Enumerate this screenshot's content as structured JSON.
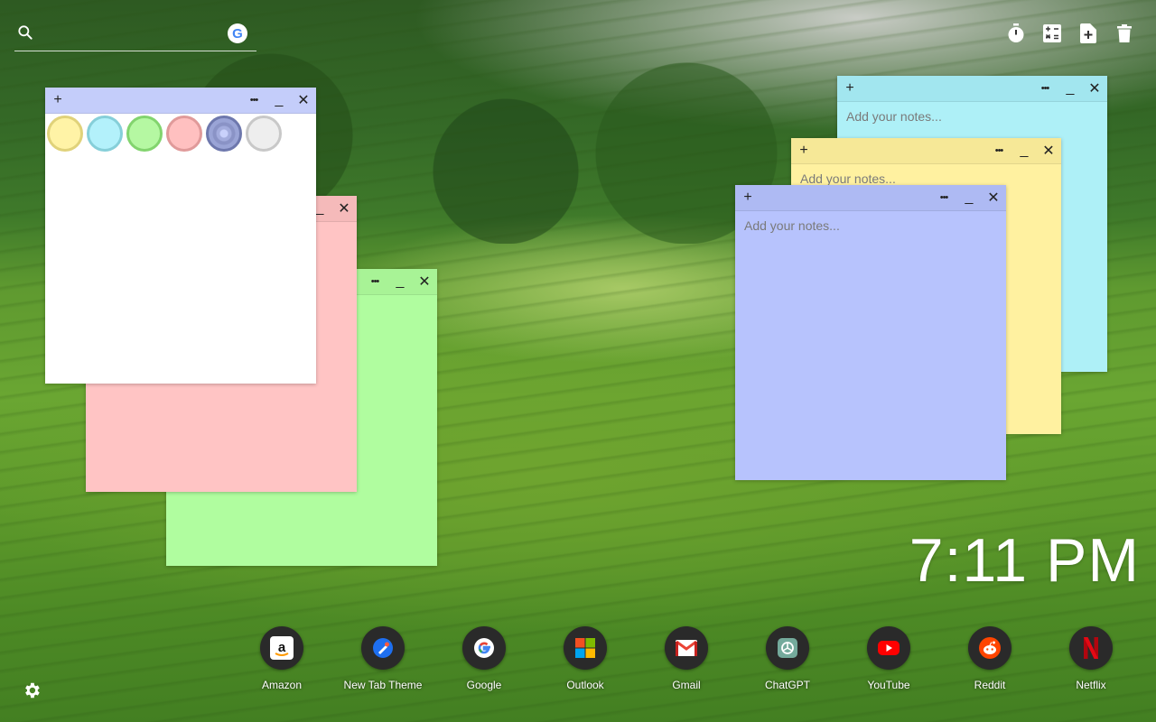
{
  "search": {
    "placeholder": "",
    "engine_icon": "google-g-icon",
    "engine_letter": "G"
  },
  "toolbar": {
    "icons": [
      "timer-icon",
      "calculator-icon",
      "new-note-icon",
      "trash-icon"
    ]
  },
  "notes": {
    "placeholder": "Add your notes...",
    "add_label": "+",
    "menu_label": "•••",
    "minimize_label": "_",
    "close_label": "✕",
    "colors": [
      "#f7ec9c",
      "#aef0f7",
      "#b0f59e",
      "#ffc4c4",
      "#b9c4fd",
      "#eeeeee"
    ],
    "picker_colors": [
      {
        "name": "yellow",
        "fill": "#fff3a6",
        "ring": "#e0d27a"
      },
      {
        "name": "cyan",
        "fill": "#b3f1fb",
        "ring": "#86cfd9"
      },
      {
        "name": "green",
        "fill": "#b5f8a2",
        "ring": "#82d46e"
      },
      {
        "name": "pink",
        "fill": "#ffc0c0",
        "ring": "#e09a9a"
      },
      {
        "name": "blue",
        "fill": "#9aa4d6",
        "ring": "#6e78ad"
      },
      {
        "name": "gray",
        "fill": "#eeeeee",
        "ring": "#c8c8c8"
      }
    ]
  },
  "clock": {
    "time": "7:11 PM"
  },
  "shortcuts": [
    {
      "label": "Amazon",
      "icon": "amazon-icon"
    },
    {
      "label": "New Tab Theme",
      "icon": "new-tab-theme-icon"
    },
    {
      "label": "Google",
      "icon": "google-icon"
    },
    {
      "label": "Outlook",
      "icon": "outlook-icon"
    },
    {
      "label": "Gmail",
      "icon": "gmail-icon"
    },
    {
      "label": "ChatGPT",
      "icon": "chatgpt-icon"
    },
    {
      "label": "YouTube",
      "icon": "youtube-icon"
    },
    {
      "label": "Reddit",
      "icon": "reddit-icon"
    },
    {
      "label": "Netflix",
      "icon": "netflix-icon"
    }
  ],
  "settings": {
    "icon": "gear-icon"
  }
}
